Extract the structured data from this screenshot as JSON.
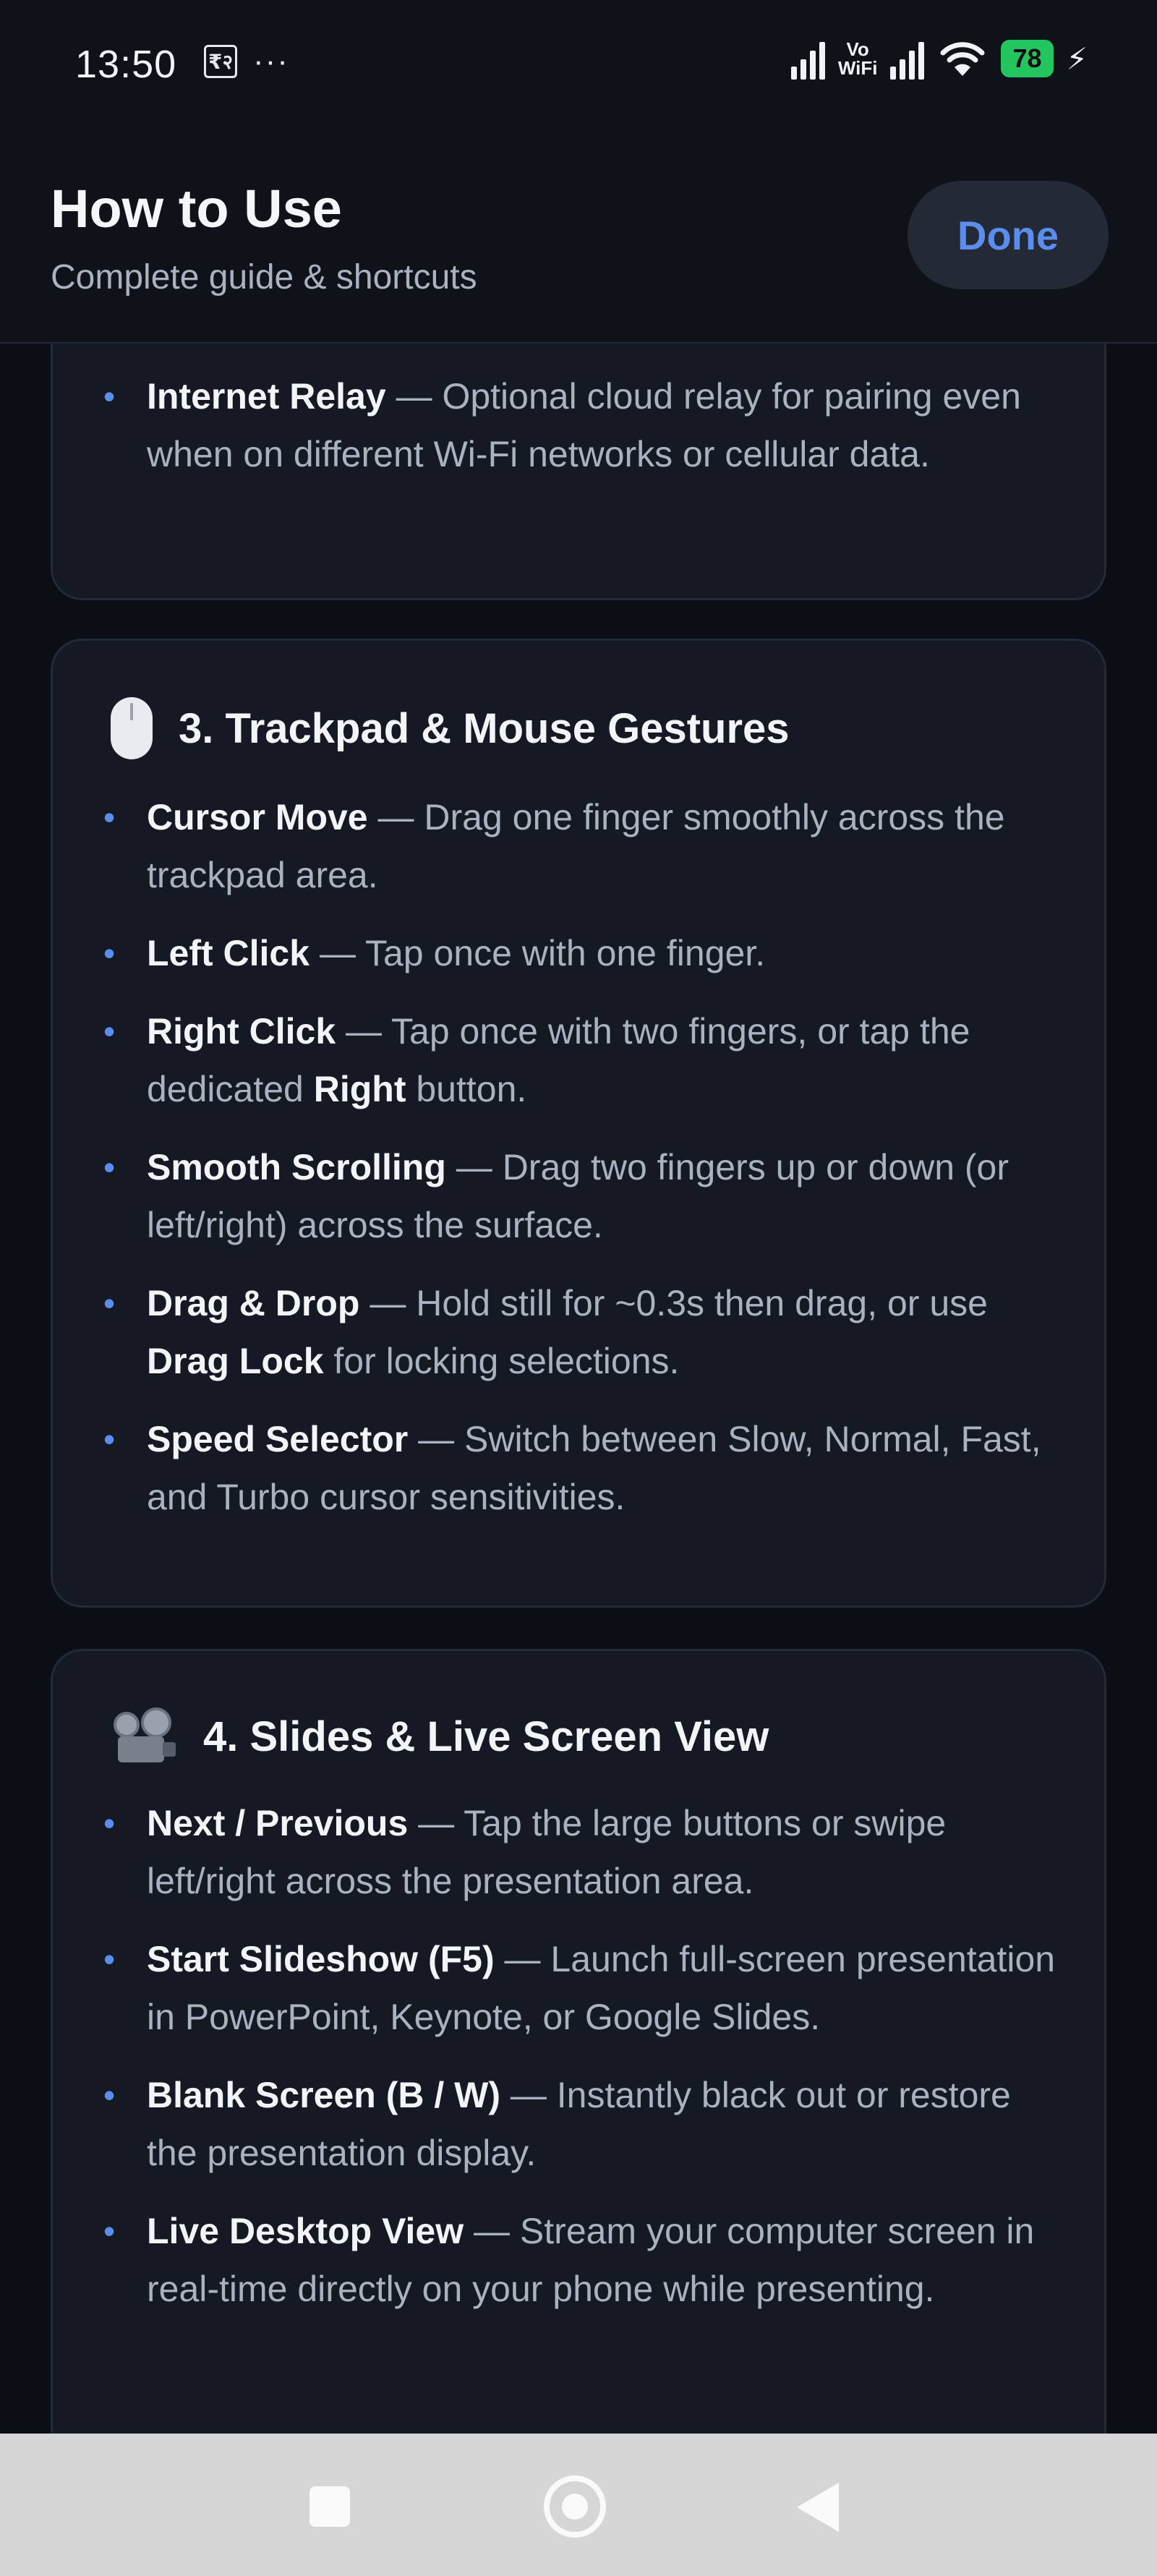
{
  "status_bar": {
    "time": "13:50",
    "currency_icon_text": "₹२",
    "more": "···",
    "vowifi_top": "Vo",
    "vowifi_bottom": "WiFi",
    "battery": "78",
    "battery_color": "#22c55e"
  },
  "header": {
    "title": "How to Use",
    "subtitle": "Complete guide & shortcuts",
    "done_label": "Done",
    "accent": "#5b8dee"
  },
  "sections": {
    "relay_item": {
      "term": "Internet Relay",
      "desc": " — Optional cloud relay for pairing even when on different Wi-Fi networks or cellular data."
    },
    "trackpad": {
      "icon": "computer-mouse-icon",
      "title": "3. Trackpad & Mouse Gestures",
      "items": [
        {
          "term": "Cursor Move",
          "desc": " — Drag one finger smoothly across the trackpad area."
        },
        {
          "term": "Left Click",
          "desc": " — Tap once with one finger."
        },
        {
          "term": "Right Click",
          "desc": " — Tap once with two fingers, or tap the dedicated ",
          "term2": "Right",
          "desc2": " button."
        },
        {
          "term": "Smooth Scrolling",
          "desc": " — Drag two fingers up or down (or left/right) across the surface."
        },
        {
          "term": "Drag & Drop",
          "desc": " — Hold still for ~0.3s then drag, or use ",
          "term2": "Drag Lock",
          "desc2": " for locking selections."
        },
        {
          "term": "Speed Selector",
          "desc": " — Switch between Slow, Normal, Fast, and Turbo cursor sensitivities."
        }
      ]
    },
    "slides": {
      "icon": "film-projector-icon",
      "title": "4. Slides & Live Screen View",
      "items": [
        {
          "term": "Next / Previous",
          "desc": " — Tap the large buttons or swipe left/right across the presentation area."
        },
        {
          "term": "Start Slideshow (F5)",
          "desc": " — Launch full-screen presentation in PowerPoint, Keynote, or Google Slides."
        },
        {
          "term": "Blank Screen (B / W)",
          "desc": " — Instantly black out or restore the presentation display."
        },
        {
          "term": "Live Desktop View",
          "desc": " — Stream your computer screen in real-time directly on your phone while presenting."
        }
      ]
    }
  },
  "nav_bar": {
    "recents": "square-icon",
    "home": "circle-icon",
    "back": "triangle-back-icon"
  }
}
